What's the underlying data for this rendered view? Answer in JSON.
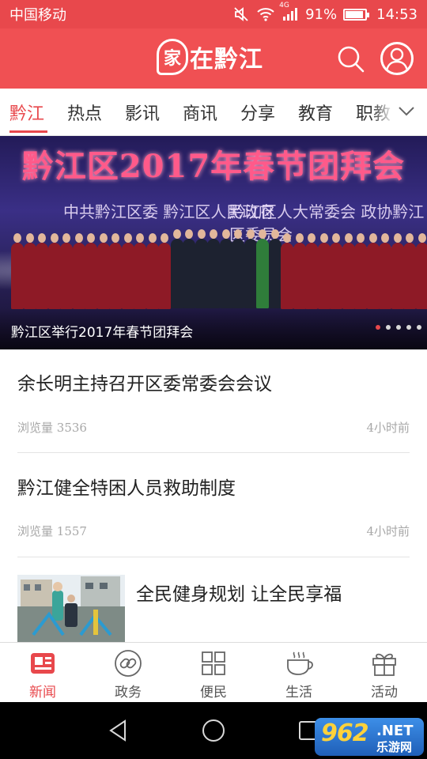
{
  "status_bar": {
    "carrier": "中国移动",
    "network": "4G",
    "battery": "91%",
    "battery_level": 0.91,
    "time": "14:53"
  },
  "header": {
    "logo_mark": "家",
    "logo_text": "在黔江",
    "brand_color": "#f05053",
    "search_icon": "search-icon",
    "avatar_icon": "user-avatar-icon"
  },
  "tabs": {
    "items": [
      {
        "label": "黔江",
        "active": true
      },
      {
        "label": "热点",
        "active": false
      },
      {
        "label": "影讯",
        "active": false
      },
      {
        "label": "商讯",
        "active": false
      },
      {
        "label": "分享",
        "active": false
      },
      {
        "label": "教育",
        "active": false
      },
      {
        "label": "职教",
        "active": false
      }
    ],
    "more_icon": "chevron-down-icon"
  },
  "banner": {
    "image_title": "黔江区2017年春节团拜会",
    "image_subtitle_left": "中共黔江区委  黔江区人民政府",
    "image_subtitle_right": "黔江区人大常委会  政协黔江区委员会",
    "caption": "黔江区举行2017年春节团拜会",
    "slide_count": 5,
    "active_slide": 0
  },
  "news": [
    {
      "title": "余长明主持召开区委常委会会议",
      "views_label": "浏览量",
      "views": "3536",
      "time": "4小时前"
    },
    {
      "title": "黔江健全特困人员救助制度",
      "views_label": "浏览量",
      "views": "1557",
      "time": "4小时前"
    },
    {
      "title": "全民健身规划 让全民享福",
      "has_thumbnail": true
    }
  ],
  "bottom_nav": {
    "items": [
      {
        "label": "新闻",
        "icon": "news-icon",
        "active": true
      },
      {
        "label": "政务",
        "icon": "link-icon",
        "active": false
      },
      {
        "label": "便民",
        "icon": "grid-icon",
        "active": false
      },
      {
        "label": "生活",
        "icon": "coffee-cup-icon",
        "active": false
      },
      {
        "label": "活动",
        "icon": "gift-icon",
        "active": false
      }
    ]
  },
  "watermark": {
    "number": "962",
    "suffix": ".NET",
    "name": "乐游网"
  },
  "colors": {
    "accent": "#e8484c",
    "text": "#222222",
    "meta": "#a8a8a8"
  }
}
